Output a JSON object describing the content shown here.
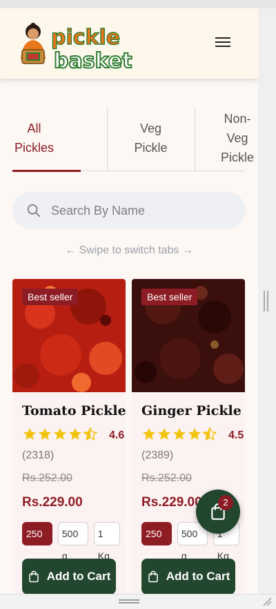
{
  "brand": {
    "name_top": "pickle",
    "name_bottom": "basket"
  },
  "tabs": [
    {
      "label_line1": "All",
      "label_line2": "Pickles",
      "active": true
    },
    {
      "label_line1": "Veg",
      "label_line2": "Pickle",
      "active": false
    },
    {
      "label_line1": "Non-",
      "label_line2": "Veg",
      "label_line3": "Pickle",
      "active": false
    }
  ],
  "search": {
    "placeholder": "Search By Name"
  },
  "swipe_hint": "← Swipe to switch tabs →",
  "products": [
    {
      "badge": "Best seller",
      "name": "Tomato Pickle",
      "rating": "4.6",
      "stars": 4.5,
      "reviews": "(2318)",
      "old_price": "Rs.252.00",
      "price": "Rs.229.00",
      "sizes": [
        "250 g",
        "500 g",
        "1 Kg"
      ],
      "selected_size": "250 g",
      "add_label": "Add to Cart",
      "image_color": "#b61e12"
    },
    {
      "badge": "Best seller",
      "name": "Ginger Pickle",
      "rating": "4.5",
      "stars": 4.5,
      "reviews": "(2389)",
      "old_price": "Rs.252.00",
      "price": "Rs.229.00",
      "sizes": [
        "250 g",
        "500 g",
        "1 Kg"
      ],
      "selected_size": "250 g",
      "add_label": "Add to Cart",
      "image_color": "#3b0f0c"
    }
  ],
  "cart": {
    "count": "2"
  },
  "colors": {
    "accent": "#8d1c24",
    "button": "#23472e",
    "star": "#f2c40f",
    "brand_green": "#2e7d32",
    "brand_orange": "#e8761a"
  }
}
